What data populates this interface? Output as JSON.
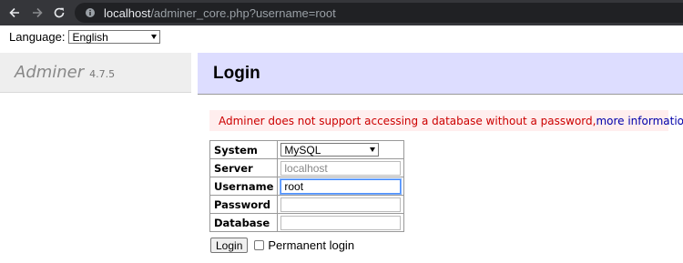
{
  "browser": {
    "url_host": "localhost",
    "url_path": "/adminer_core.php?username=root"
  },
  "language": {
    "label": "Language:",
    "selected": "English"
  },
  "sidebar": {
    "brand": "Adminer",
    "version": "4.7.5"
  },
  "main": {
    "title": "Login",
    "error_text": "Adminer does not support accessing a database without a password, ",
    "error_link": "more information",
    "error_end": "."
  },
  "login_form": {
    "system_label": "System",
    "system_value": "MySQL",
    "server_label": "Server",
    "server_placeholder": "localhost",
    "username_label": "Username",
    "username_value": "root",
    "password_label": "Password",
    "password_value": "",
    "database_label": "Database",
    "database_value": "",
    "login_button": "Login",
    "permanent_login_label": "Permanent login"
  },
  "colors": {
    "header_bg": "#ddddff",
    "error_bg": "#ffeeee",
    "error_text": "#cc0000",
    "link": "#0000aa"
  }
}
